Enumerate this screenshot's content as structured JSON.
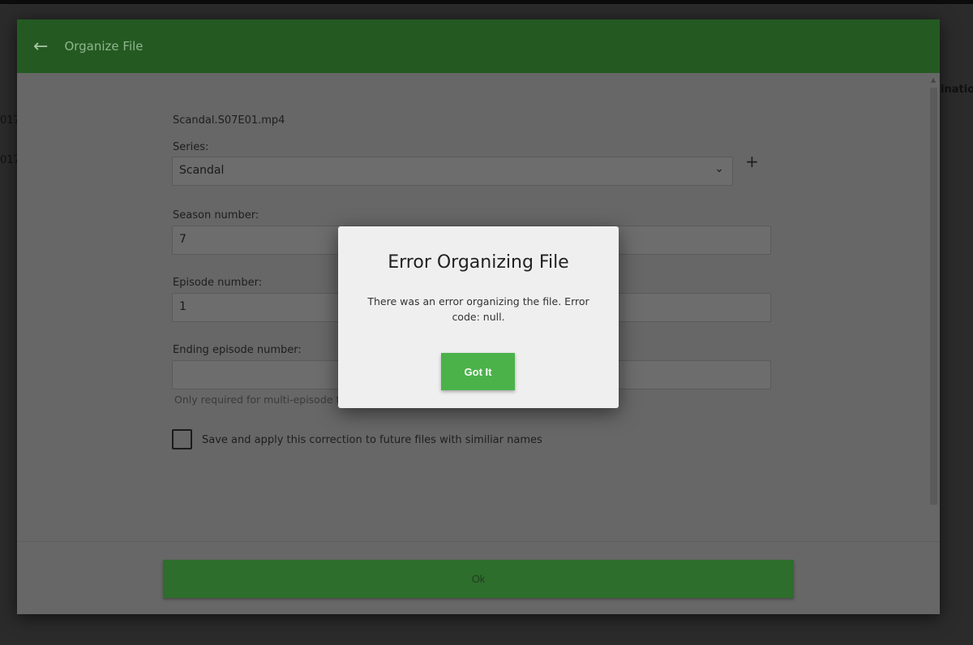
{
  "background": {
    "left_text_1": "017",
    "left_text_2": "017",
    "right_text": "inatio"
  },
  "modal": {
    "title": "Organize File",
    "filename": "Scandal.S07E01.mp4",
    "series_label": "Series:",
    "series_value": "Scandal",
    "season_label": "Season number:",
    "season_value": "7",
    "episode_label": "Episode number:",
    "episode_value": "1",
    "ending_label": "Ending episode number:",
    "ending_value": "",
    "ending_help": "Only required for multi-episode files",
    "save_checkbox_label": "Save and apply this correction to future files with similiar names",
    "ok_label": "Ok"
  },
  "dialog": {
    "title": "Error Organizing File",
    "message": "There was an error organizing the file. Error code: null.",
    "button": "Got It"
  }
}
